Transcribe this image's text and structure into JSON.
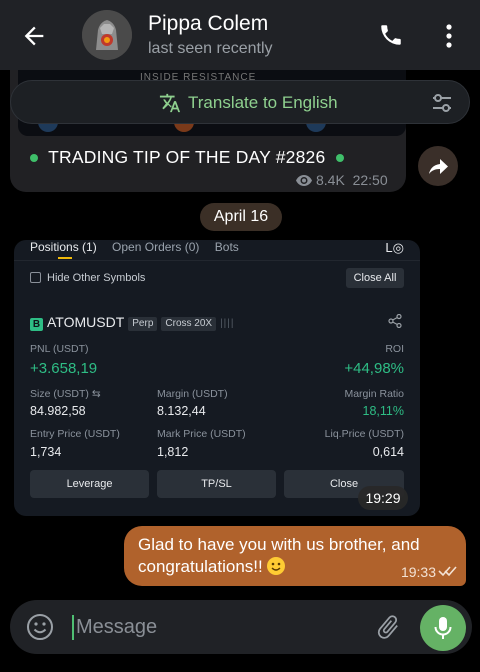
{
  "header": {
    "name": "Pippa Colem",
    "status": "last seen recently"
  },
  "message_top": {
    "partial_text": "INSIDE RESISTANCE",
    "translate_label": "Translate to English",
    "tip_text": "TRADING TIP OF THE DAY #2826",
    "views": "8.4K",
    "time": "22:50"
  },
  "date_divider": "April 16",
  "screenshot": {
    "tabs": [
      "Positions (1)",
      "Open Orders (0)",
      "Bots"
    ],
    "hide_other": "Hide Other Symbols",
    "close_all": "Close All",
    "exchange_badge": "B",
    "symbol": "ATOMUSDT",
    "tag_perp": "Perp",
    "tag_cross": "Cross 20X",
    "pnl_label": "PNL (USDT)",
    "pnl_value": "+3.658,19",
    "roi_label": "ROI",
    "roi_value": "+44,98%",
    "size_label": "Size (USDT) ⇆",
    "size_value": "84.982,58",
    "margin_label": "Margin (USDT)",
    "margin_value": "8.132,44",
    "margin_ratio_label": "Margin Ratio",
    "margin_ratio_value": "18,11%",
    "entry_label": "Entry Price (USDT)",
    "entry_value": "1,734",
    "mark_label": "Mark Price (USDT)",
    "mark_value": "1,812",
    "liq_label": "Liq.Price (USDT)",
    "liq_value": "0,614",
    "btn_leverage": "Leverage",
    "btn_tpsl": "TP/SL",
    "btn_close": "Close",
    "time": "19:29"
  },
  "outgoing": {
    "text": "Glad to have you with us brother, and congratulations!!",
    "time": "19:33"
  },
  "composer": {
    "placeholder": "Message"
  },
  "colors": {
    "header_bg": "#202226",
    "outgoing_bubble": "#b0622c",
    "accent_green": "#65b265",
    "profit_green": "#2ebd85"
  },
  "icons": [
    "back-arrow-icon",
    "phone-icon",
    "more-vert-icon",
    "translate-icon",
    "tune-icon",
    "eye-icon",
    "share-icon",
    "emoji-icon",
    "attach-icon",
    "mic-icon",
    "double-check-icon"
  ]
}
